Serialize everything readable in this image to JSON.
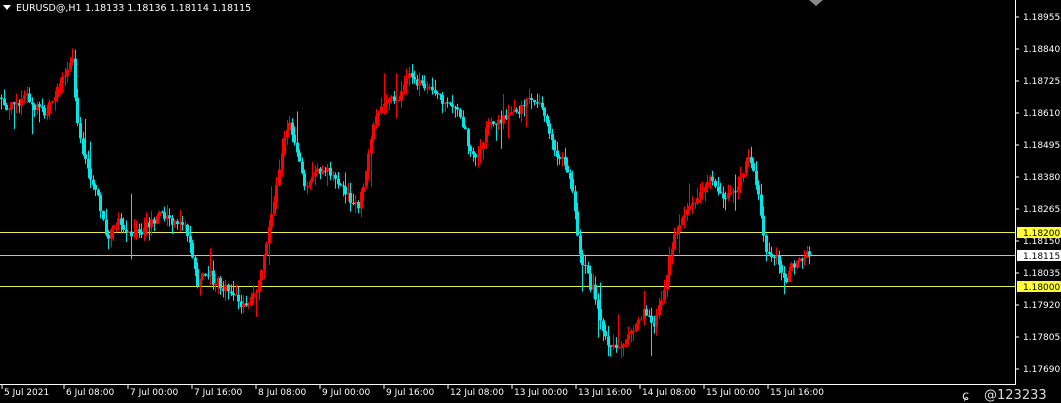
{
  "header": {
    "symbol": "EURUSD@,H1",
    "ohlc": "1.18133 1.18136 1.18114 1.18115"
  },
  "watermark": "@123233",
  "colors": {
    "background": "#000000",
    "bull": "#ff0000",
    "bear": "#00e5e5",
    "level_line": "#e8e84a",
    "price_line": "#bfbfbf",
    "axis": "#ffffff"
  },
  "chart_data": {
    "type": "candlestick",
    "title": "",
    "y_tick_labels": [
      "1.18955",
      "1.18840",
      "1.18725",
      "1.18610",
      "1.18495",
      "1.18380",
      "1.18265",
      "1.18150",
      "1.18035",
      "1.17920",
      "1.17805",
      "1.17690"
    ],
    "ylim": [
      1.1769,
      1.19
    ],
    "x_tick_labels": [
      "5 Jul 2021",
      "6 Jul 08:00",
      "7 Jul 00:00",
      "7 Jul 16:00",
      "8 Jul 08:00",
      "9 Jul 00:00",
      "9 Jul 16:00",
      "12 Jul 08:00",
      "13 Jul 00:00",
      "13 Jul 16:00",
      "14 Jul 08:00",
      "15 Jul 00:00",
      "15 Jul 16:00"
    ],
    "levels": [
      {
        "label": "1.18200",
        "value": 1.182,
        "style": "highlight"
      },
      {
        "label": "1.18115",
        "value": 1.18115,
        "style": "current"
      },
      {
        "label": "1.18000",
        "value": 1.18,
        "style": "highlight"
      }
    ],
    "path": [
      [
        0,
        1.187
      ],
      [
        5,
        1.1866
      ],
      [
        10,
        1.1868
      ],
      [
        14,
        1.1866
      ],
      [
        18,
        1.1868
      ],
      [
        24,
        1.1872
      ],
      [
        30,
        1.1868
      ],
      [
        35,
        1.1866
      ],
      [
        40,
        1.1866
      ],
      [
        44,
        1.1864
      ],
      [
        48,
        1.1866
      ],
      [
        53,
        1.187
      ],
      [
        58,
        1.1873
      ],
      [
        63,
        1.1877
      ],
      [
        68,
        1.1882
      ],
      [
        72,
        1.1886
      ],
      [
        76,
        1.1866
      ],
      [
        80,
        1.1855
      ],
      [
        84,
        1.1848
      ],
      [
        88,
        1.1842
      ],
      [
        92,
        1.184
      ],
      [
        96,
        1.1836
      ],
      [
        100,
        1.183
      ],
      [
        104,
        1.1822
      ],
      [
        108,
        1.1818
      ],
      [
        112,
        1.1822
      ],
      [
        118,
        1.1824
      ],
      [
        124,
        1.182
      ],
      [
        132,
        1.182
      ],
      [
        140,
        1.182
      ],
      [
        146,
        1.1822
      ],
      [
        152,
        1.1824
      ],
      [
        158,
        1.1826
      ],
      [
        163,
        1.1826
      ],
      [
        168,
        1.1824
      ],
      [
        173,
        1.1824
      ],
      [
        178,
        1.1822
      ],
      [
        182,
        1.1824
      ],
      [
        186,
        1.1822
      ],
      [
        190,
        1.1814
      ],
      [
        194,
        1.1808
      ],
      [
        198,
        1.18
      ],
      [
        202,
        1.1804
      ],
      [
        206,
        1.1806
      ],
      [
        210,
        1.1804
      ],
      [
        214,
        1.18
      ],
      [
        218,
        1.1802
      ],
      [
        222,
        1.1798
      ],
      [
        226,
        1.18
      ],
      [
        230,
        1.1797
      ],
      [
        234,
        1.1796
      ],
      [
        238,
        1.1796
      ],
      [
        242,
        1.1792
      ],
      [
        246,
        1.1792
      ],
      [
        250,
        1.1794
      ],
      [
        254,
        1.1796
      ],
      [
        258,
        1.18
      ],
      [
        262,
        1.1808
      ],
      [
        266,
        1.1816
      ],
      [
        270,
        1.1824
      ],
      [
        274,
        1.1832
      ],
      [
        278,
        1.1842
      ],
      [
        282,
        1.185
      ],
      [
        286,
        1.1858
      ],
      [
        290,
        1.1862
      ],
      [
        294,
        1.1852
      ],
      [
        298,
        1.1848
      ],
      [
        302,
        1.1842
      ],
      [
        306,
        1.1836
      ],
      [
        310,
        1.1838
      ],
      [
        314,
        1.1842
      ],
      [
        318,
        1.1844
      ],
      [
        322,
        1.1842
      ],
      [
        326,
        1.1844
      ],
      [
        330,
        1.1842
      ],
      [
        334,
        1.184
      ],
      [
        338,
        1.1838
      ],
      [
        342,
        1.1836
      ],
      [
        346,
        1.1834
      ],
      [
        350,
        1.1832
      ],
      [
        354,
        1.183
      ],
      [
        358,
        1.183
      ],
      [
        362,
        1.1836
      ],
      [
        366,
        1.1844
      ],
      [
        370,
        1.1852
      ],
      [
        374,
        1.186
      ],
      [
        378,
        1.1864
      ],
      [
        382,
        1.1866
      ],
      [
        386,
        1.1868
      ],
      [
        390,
        1.1872
      ],
      [
        394,
        1.1868
      ],
      [
        398,
        1.187
      ],
      [
        402,
        1.1874
      ],
      [
        406,
        1.1876
      ],
      [
        410,
        1.1878
      ],
      [
        414,
        1.1876
      ],
      [
        418,
        1.1876
      ],
      [
        422,
        1.1874
      ],
      [
        426,
        1.1874
      ],
      [
        430,
        1.1872
      ],
      [
        434,
        1.1872
      ],
      [
        438,
        1.187
      ],
      [
        442,
        1.1868
      ],
      [
        446,
        1.1868
      ],
      [
        450,
        1.1866
      ],
      [
        454,
        1.1868
      ],
      [
        458,
        1.1866
      ],
      [
        462,
        1.186
      ],
      [
        466,
        1.1856
      ],
      [
        470,
        1.185
      ],
      [
        474,
        1.1846
      ],
      [
        478,
        1.1848
      ],
      [
        482,
        1.1852
      ],
      [
        486,
        1.1858
      ],
      [
        490,
        1.186
      ],
      [
        494,
        1.186
      ],
      [
        498,
        1.186
      ],
      [
        502,
        1.1862
      ],
      [
        508,
        1.1862
      ],
      [
        514,
        1.1864
      ],
      [
        520,
        1.1866
      ],
      [
        526,
        1.1868
      ],
      [
        532,
        1.187
      ],
      [
        538,
        1.1868
      ],
      [
        542,
        1.1866
      ],
      [
        546,
        1.1862
      ],
      [
        550,
        1.1856
      ],
      [
        554,
        1.1852
      ],
      [
        558,
        1.1848
      ],
      [
        562,
        1.1848
      ],
      [
        566,
        1.1844
      ],
      [
        570,
        1.1838
      ],
      [
        574,
        1.183
      ],
      [
        578,
        1.1818
      ],
      [
        582,
        1.1808
      ],
      [
        586,
        1.1806
      ],
      [
        590,
        1.18
      ],
      [
        594,
        1.1798
      ],
      [
        598,
        1.179
      ],
      [
        602,
        1.1784
      ],
      [
        606,
        1.1779
      ],
      [
        610,
        1.1778
      ],
      [
        614,
        1.1778
      ],
      [
        618,
        1.1778
      ],
      [
        622,
        1.1778
      ],
      [
        626,
        1.178
      ],
      [
        630,
        1.1782
      ],
      [
        634,
        1.1784
      ],
      [
        638,
        1.1786
      ],
      [
        642,
        1.179
      ],
      [
        646,
        1.179
      ],
      [
        650,
        1.1786
      ],
      [
        654,
        1.1784
      ],
      [
        658,
        1.179
      ],
      [
        662,
        1.1796
      ],
      [
        666,
        1.1804
      ],
      [
        670,
        1.1812
      ],
      [
        674,
        1.1818
      ],
      [
        678,
        1.182
      ],
      [
        682,
        1.1824
      ],
      [
        686,
        1.1826
      ],
      [
        690,
        1.183
      ],
      [
        694,
        1.1832
      ],
      [
        698,
        1.1834
      ],
      [
        702,
        1.1836
      ],
      [
        706,
        1.1838
      ],
      [
        710,
        1.184
      ],
      [
        714,
        1.1838
      ],
      [
        718,
        1.1834
      ],
      [
        722,
        1.1832
      ],
      [
        726,
        1.1832
      ],
      [
        730,
        1.1834
      ],
      [
        734,
        1.1834
      ],
      [
        738,
        1.1838
      ],
      [
        742,
        1.184
      ],
      [
        746,
        1.1846
      ],
      [
        750,
        1.1848
      ],
      [
        754,
        1.1842
      ],
      [
        758,
        1.1834
      ],
      [
        762,
        1.1822
      ],
      [
        766,
        1.1812
      ],
      [
        770,
        1.181
      ],
      [
        774,
        1.1812
      ],
      [
        778,
        1.1808
      ],
      [
        782,
        1.1804
      ],
      [
        786,
        1.1802
      ],
      [
        790,
        1.1806
      ],
      [
        794,
        1.1808
      ],
      [
        798,
        1.181
      ],
      [
        802,
        1.181
      ],
      [
        806,
        1.1812
      ],
      [
        810,
        1.1812
      ]
    ]
  }
}
